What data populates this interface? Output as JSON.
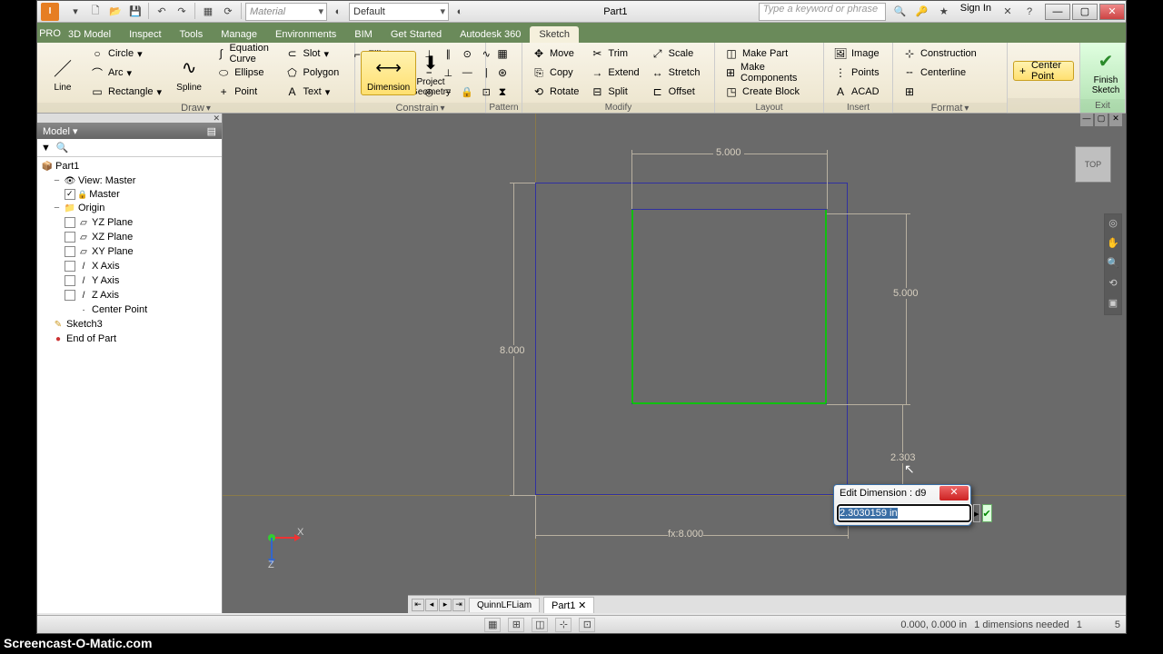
{
  "title": "Part1",
  "search_placeholder": "Type a keyword or phrase",
  "signin": "Sign In",
  "material_combo": "Material",
  "appearance_combo": "Default",
  "tabs": [
    "3D Model",
    "Inspect",
    "Tools",
    "Manage",
    "Environments",
    "BIM",
    "Get Started",
    "Autodesk 360",
    "Sketch"
  ],
  "active_tab": 8,
  "ribbon": {
    "line": "Line",
    "circle": "Circle",
    "arc": "Arc",
    "rectangle": "Rectangle",
    "spline": "Spline",
    "slot": "Slot",
    "eqcurve": "Equation Curve",
    "ellipse": "Ellipse",
    "polygon": "Polygon",
    "fillet": "Fillet",
    "point": "Point",
    "text": "Text",
    "project": "Project Geometry",
    "dimension": "Dimension",
    "move": "Move",
    "copy": "Copy",
    "rotate": "Rotate",
    "trim": "Trim",
    "extend": "Extend",
    "split": "Split",
    "scale": "Scale",
    "stretch": "Stretch",
    "offset": "Offset",
    "makepart": "Make Part",
    "makecomp": "Make Components",
    "createblock": "Create Block",
    "image": "Image",
    "points": "Points",
    "acad": "ACAD",
    "construction": "Construction",
    "centerline": "Centerline",
    "centerpoint": "Center Point",
    "finish": "Finish Sketch",
    "panels": {
      "draw": "Draw",
      "constrain": "Constrain",
      "pattern": "Pattern",
      "modify": "Modify",
      "layout": "Layout",
      "insert": "Insert",
      "format": "Format",
      "exit": "Exit"
    }
  },
  "browser": {
    "title": "Model",
    "part": "Part1",
    "view": "View: Master",
    "master": "Master",
    "origin": "Origin",
    "planes": [
      "YZ Plane",
      "XZ Plane",
      "XY Plane",
      "X Axis",
      "Y Axis",
      "Z Axis",
      "Center Point"
    ],
    "sketch": "Sketch3",
    "eop": "End of Part"
  },
  "dims": {
    "d1": "5.000",
    "d2": "5.000",
    "d3": "8.000",
    "d4": "fx:8.000",
    "d5": "2.303"
  },
  "viewcube": "TOP",
  "dialog": {
    "title": "Edit Dimension : d9",
    "value": "2.3030159 in"
  },
  "doctabs": [
    "QuinnLFLiam",
    "Part1"
  ],
  "status": {
    "coords": "0.000, 0.000 in",
    "msg": "1 dimensions needed",
    "n1": "1",
    "n2": "5"
  },
  "watermark": "Screencast-O-Matic.com"
}
